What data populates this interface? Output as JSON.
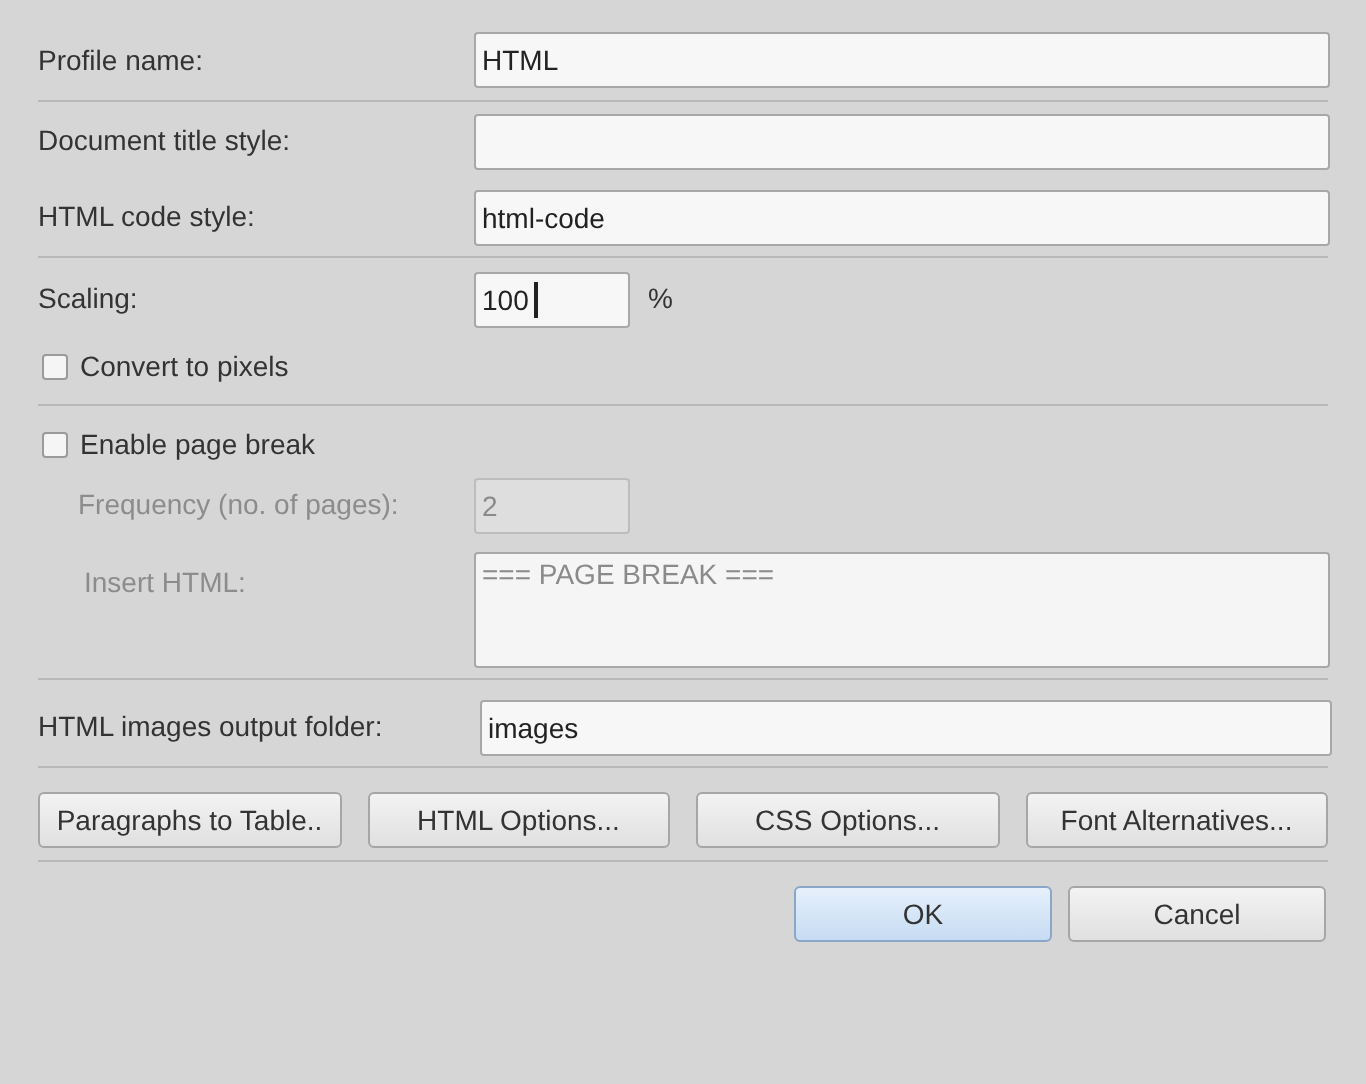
{
  "profile": {
    "label": "Profile name:",
    "value": "HTML"
  },
  "styles": [
    {
      "label": "Document title style:"
    },
    {
      "label": "HTML code style:",
      "value": "html-code"
    }
  ],
  "scaling": {
    "label": "Scaling:",
    "value": "100",
    "unit": "%",
    "focused": true
  },
  "convert": {
    "label": "Convert to pixels",
    "checked": false
  },
  "page_break": {
    "label": "Enable page break",
    "checked": false,
    "frequency": {
      "label": "Frequency (no. of pages):",
      "value": "2",
      "disabled": true
    },
    "insert_html": {
      "label": "Insert HTML:",
      "value": "=== PAGE BREAK ===",
      "disabled": true
    }
  },
  "images_folder": {
    "label": "HTML images output folder:",
    "value": "images"
  },
  "option_buttons": [
    "Paragraphs to Table..",
    "HTML Options...",
    "CSS Options...",
    "Font Alternatives..."
  ],
  "dialog_buttons": [
    {
      "label": "OK",
      "default": true
    },
    {
      "label": "Cancel",
      "default": false
    }
  ]
}
